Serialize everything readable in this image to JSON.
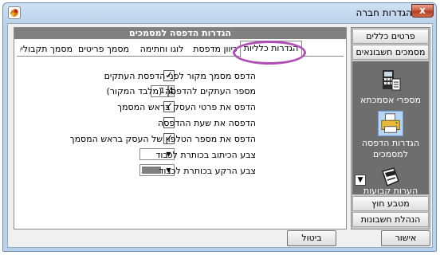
{
  "window": {
    "title": "הגדרות חברה",
    "close_label": "x"
  },
  "nav": {
    "top_headers": [
      {
        "name": "nav-header-general",
        "label": "פרטים כללים"
      },
      {
        "name": "nav-header-accounting-docs",
        "label": "מסמכים חשבונאים"
      }
    ],
    "tiles": [
      {
        "name": "nav-tile-document-numbers",
        "label": "מספרי אסמכתא",
        "icon": "calculator-icon",
        "selected": false
      },
      {
        "name": "nav-tile-print-settings",
        "label": "הגדרות הדפסה למסמכים",
        "icon": "printer-icon",
        "selected": true
      },
      {
        "name": "nav-tile-fixed-notes",
        "label": "הערות קבועות",
        "icon": "notes-icon",
        "selected": false
      }
    ],
    "bottom_headers": [
      {
        "name": "nav-header-foreign-currency",
        "label": "מטבע חוץ"
      },
      {
        "name": "nav-header-bookkeeping",
        "label": "הנהלת חשבונות"
      }
    ]
  },
  "panel": {
    "title": "הגדרות הדפסה למסמכים",
    "tabs": [
      {
        "label": "הגדרות כלליות",
        "selected": true
      },
      {
        "label": "כיוון מדפסת",
        "selected": false
      },
      {
        "label": "לוגו וחתימה",
        "selected": false
      },
      {
        "label": "מסמך פריטים",
        "selected": false
      },
      {
        "label": "מסמך תקבולים",
        "selected": false
      }
    ],
    "options": {
      "print_original_label": "הדפס מסמך מקור לפני הדפסת העתקים",
      "print_original_checked": true,
      "copies_label": "מספר העתקים להדפסה (מלבד המקור)",
      "copies_value": "1",
      "print_business_label": "הדפס את פרטי העסק בראש המסמך",
      "print_business_checked": true,
      "print_time_label": "הדפסה את שעת ההדפסה",
      "print_time_checked": false,
      "print_phone_label": "הדפס את מספר הטלפון של העסק בראש המסמך",
      "print_phone_checked": true,
      "text_color_label": "צבע הכיתוב בכותרת לכבוד",
      "text_color": "#ffffff",
      "bg_color_label": "צבע הרקע בכותרת לכבוד",
      "bg_color": "#808080"
    }
  },
  "buttons": {
    "ok": "אישור",
    "cancel": "ביטול"
  },
  "colors": {
    "highlight_ring": "#b04fb5",
    "nav_background": "#6e6e6e"
  }
}
